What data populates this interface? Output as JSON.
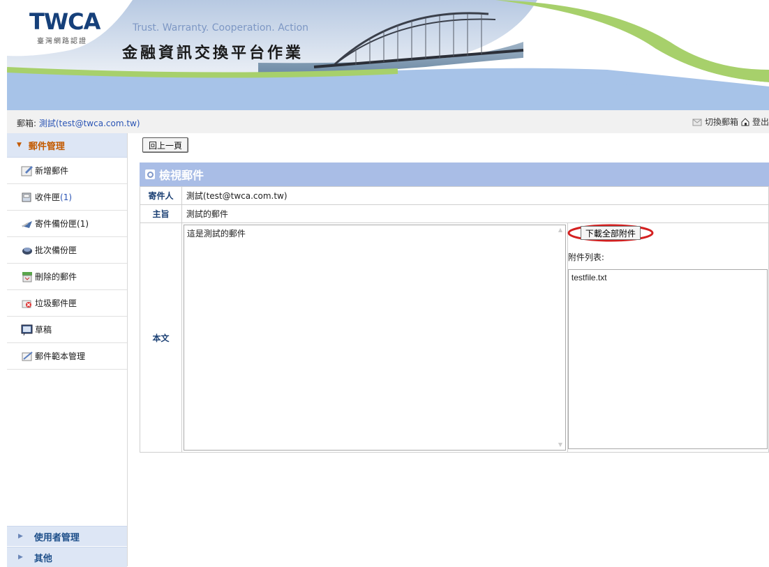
{
  "header": {
    "logo_main": "TWCA",
    "logo_sub": "臺灣網路認證",
    "slogan": "Trust. Warranty. Cooperation. Action",
    "system_title": "金融資訊交換平台作業"
  },
  "mailbox_bar": {
    "prefix": "郵箱:",
    "address": "測試(test@twca.com.tw)",
    "switch_label": "切換郵箱",
    "logout_label": "登出"
  },
  "sidebar": {
    "section_title": "郵件管理",
    "items": [
      {
        "label": "新增郵件",
        "count": "",
        "icon": "compose-icon"
      },
      {
        "label": "收件匣",
        "count": "(1)",
        "icon": "inbox-icon"
      },
      {
        "label": "寄件備份匣",
        "count": "(1)",
        "icon": "sent-icon"
      },
      {
        "label": "批次備份匣",
        "count": "",
        "icon": "batch-icon"
      },
      {
        "label": "刪除的郵件",
        "count": "",
        "icon": "trash-icon"
      },
      {
        "label": "垃圾郵件匣",
        "count": "",
        "icon": "spam-icon"
      },
      {
        "label": "草稿",
        "count": "",
        "icon": "draft-icon"
      },
      {
        "label": "郵件範本管理",
        "count": "",
        "icon": "template-icon"
      }
    ],
    "footer_items": [
      "使用者管理",
      "其他"
    ]
  },
  "main": {
    "back_button": "回上一頁",
    "panel_title": "檢視郵件",
    "sender_label": "寄件人",
    "sender_value": "測試(test@twca.com.tw)",
    "subject_label": "主旨",
    "subject_value": "測試的郵件",
    "body_label": "本文",
    "body_text": "這是測試的郵件",
    "download_all_button": "下載全部附件",
    "attachments_label": "附件列表:",
    "attachments": [
      "testfile.txt"
    ]
  },
  "colors": {
    "panel_title_bg": "#a9bde6",
    "sidebar_head_bg": "#dde6f5",
    "highlight_circle": "#d42020"
  }
}
